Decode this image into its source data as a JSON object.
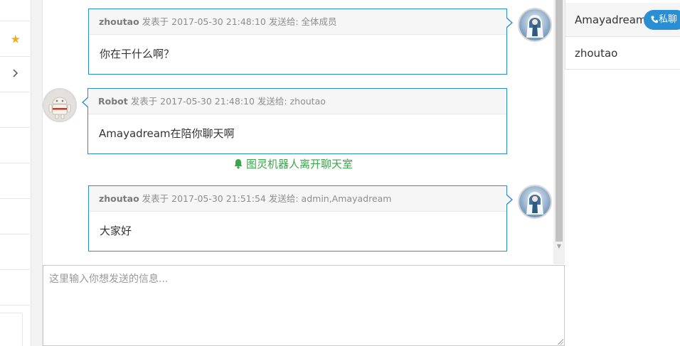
{
  "messages": [
    {
      "sender": "zhoutao",
      "sent_at_label": " 发表于 2017-05-30 21:48:10 发送给: ",
      "recipient": "全体成员",
      "text": "你在干什么啊？",
      "side": "right",
      "avatar": "anime-avatar-icon"
    },
    {
      "sender": "Robot",
      "sent_at_label": " 发表于 2017-05-30 21:48:10 发送给: ",
      "recipient": "zhoutao",
      "text": "Amayadream在陪你聊天啊",
      "side": "left",
      "avatar": "android-robot-icon"
    },
    {
      "sender": "zhoutao",
      "sent_at_label": " 发表于 2017-05-30 21:51:54 发送给: ",
      "recipient": "admin,Amayadream",
      "text": "大家好",
      "side": "right",
      "avatar": "anime-avatar-icon"
    }
  ],
  "system_notice": {
    "icon": "bell-icon",
    "text": "图灵机器人离开聊天室",
    "color": "#3aa64a"
  },
  "input": {
    "placeholder": "这里输入你想发送的信息..."
  },
  "users": [
    {
      "name": "Amayadream",
      "action_label": "私聊",
      "action_icon": "phone-icon"
    },
    {
      "name": "zhoutao"
    }
  ],
  "sidebar": {
    "icons": [
      "star-icon",
      "chevron-right-icon"
    ]
  },
  "colors": {
    "bubble_border": "#2b8cca",
    "accent_button": "#2a8ed4",
    "star": "#f0ad1e"
  }
}
